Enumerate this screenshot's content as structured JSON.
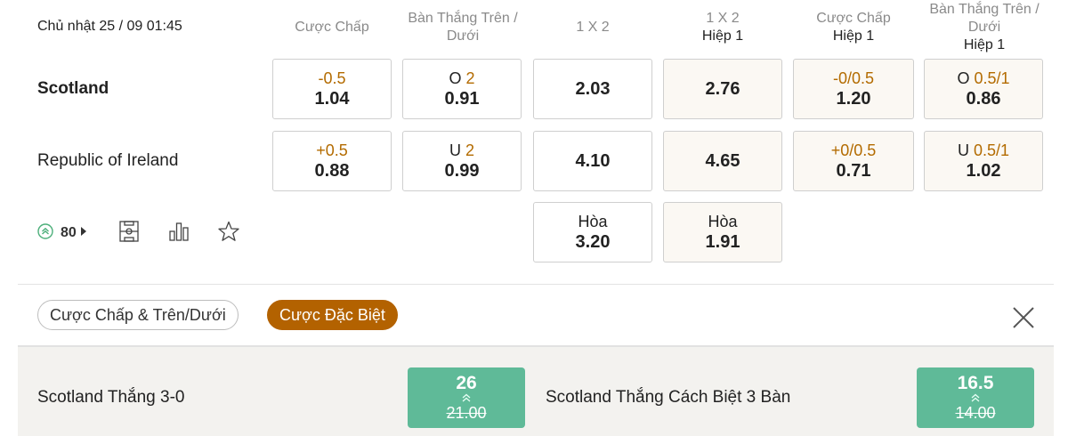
{
  "match": {
    "datetime": "Chủ nhật 25 / 09 01:45",
    "home": "Scotland",
    "away": "Republic of Ireland"
  },
  "headers": {
    "handicap": "Cược Chấp",
    "ou_line1": "Bàn Thắng Trên /",
    "ou_line2": "Dưới",
    "x12": "1 X 2",
    "x12_h1": "1 X 2",
    "x12_h1_sub": "Hiệp 1",
    "handicap_h1": "Cược Chấp",
    "handicap_h1_sub": "Hiệp 1",
    "ou_h1_line1": "Bàn Thắng Trên /",
    "ou_h1_line2": "Dưới",
    "ou_h1_sub": "Hiệp 1"
  },
  "home_row": {
    "handicap": {
      "line": "-0.5",
      "odds": "1.04"
    },
    "ou": {
      "prefix": "O",
      "line": "2",
      "odds": "0.91"
    },
    "x12": {
      "odds": "2.03"
    },
    "x12_h1": {
      "odds": "2.76"
    },
    "handicap_h1": {
      "line": "-0/0.5",
      "odds": "1.20"
    },
    "ou_h1": {
      "prefix": "O",
      "line": "0.5/1",
      "odds": "0.86"
    }
  },
  "away_row": {
    "handicap": {
      "line": "+0.5",
      "odds": "0.88"
    },
    "ou": {
      "prefix": "U",
      "line": "2",
      "odds": "0.99"
    },
    "x12": {
      "odds": "4.10"
    },
    "x12_h1": {
      "odds": "4.65"
    },
    "handicap_h1": {
      "line": "+0/0.5",
      "odds": "0.71"
    },
    "ou_h1": {
      "prefix": "U",
      "line": "0.5/1",
      "odds": "1.02"
    }
  },
  "draw_row": {
    "x12": {
      "label": "Hòa",
      "odds": "3.20"
    },
    "x12_h1": {
      "label": "Hòa",
      "odds": "1.91"
    }
  },
  "tools": {
    "more_count": "80",
    "icons": [
      "boost-icon",
      "play-arrow-icon",
      "field-icon",
      "stats-icon",
      "star-icon"
    ]
  },
  "tabs": {
    "handicap_ou": "Cược Chấp & Trên/Dưới",
    "special": "Cược Đặc Biệt"
  },
  "specials": [
    {
      "label": "Scotland Thắng 3-0",
      "odds": "26",
      "old_odds": "21.00"
    },
    {
      "label": "Scotland Thắng Cách Biệt 3 Bàn",
      "odds": "16.5",
      "old_odds": "14.00"
    }
  ],
  "colors": {
    "accent": "#b36200",
    "line_highlight": "#b36b00",
    "boost_green": "#5fba98",
    "muted_text": "#8a8a8a"
  }
}
